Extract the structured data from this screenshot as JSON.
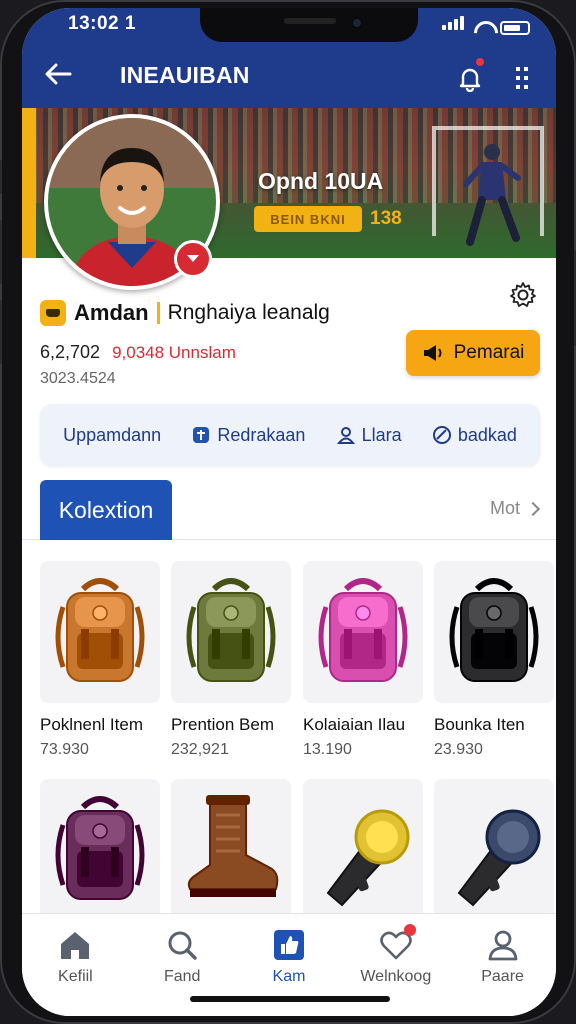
{
  "status_bar": {
    "time": "13:02 1"
  },
  "header": {
    "title": "INEAUIBAN"
  },
  "banner": {
    "headline": "Opnd 10UA",
    "tag": "BEIN BKNI",
    "number": "138"
  },
  "profile": {
    "name": "Amdan",
    "subtitle": "Rnghaiya leanalg",
    "stat_value": "6,2,702",
    "stat_red": "9,0348 Unnslam",
    "stat_sub": "3023.4524",
    "cta_label": "Pemarai"
  },
  "actions": [
    {
      "label": "Uppamdann",
      "icon": "none"
    },
    {
      "label": "Redrakaan",
      "icon": "shield-icon"
    },
    {
      "label": "Llara",
      "icon": "user-icon"
    },
    {
      "label": "badkad",
      "icon": "circle-icon"
    }
  ],
  "tabs": {
    "active": "Kolextion",
    "more": "Mot"
  },
  "products": [
    {
      "name": "Poklnenl Item",
      "price": "73.930",
      "color": "#c9772e",
      "type": "backpack"
    },
    {
      "name": "Prention Bem",
      "price": "232,921",
      "color": "#6e7a3c",
      "type": "backpack"
    },
    {
      "name": "Kolaiaian Ilau",
      "price": "13.190",
      "color": "#d94fb0",
      "type": "backpack"
    },
    {
      "name": "Bounka Iten",
      "price": "23.930",
      "color": "#2c2c2e",
      "type": "backpack"
    },
    {
      "name": "",
      "price": "",
      "color": "#6a2c5a",
      "type": "backpack"
    },
    {
      "name": "",
      "price": "",
      "color": "#8a4a22",
      "type": "boot"
    },
    {
      "name": "",
      "price": "",
      "color": "#e0c232",
      "type": "horn"
    },
    {
      "name": "",
      "price": "",
      "color": "#3b4a6b",
      "type": "horn"
    }
  ],
  "nav": [
    {
      "label": "Kefiil",
      "icon": "home-icon"
    },
    {
      "label": "Fand",
      "icon": "search-icon"
    },
    {
      "label": "Kam",
      "icon": "thumbs-up-icon"
    },
    {
      "label": "Welnkoog",
      "icon": "heart-icon"
    },
    {
      "label": "Paare",
      "icon": "user-icon"
    }
  ],
  "colors": {
    "primary": "#1f3b8c",
    "accent": "#f7a613",
    "active_tab": "#1e53b5",
    "alert": "#e8363c"
  }
}
